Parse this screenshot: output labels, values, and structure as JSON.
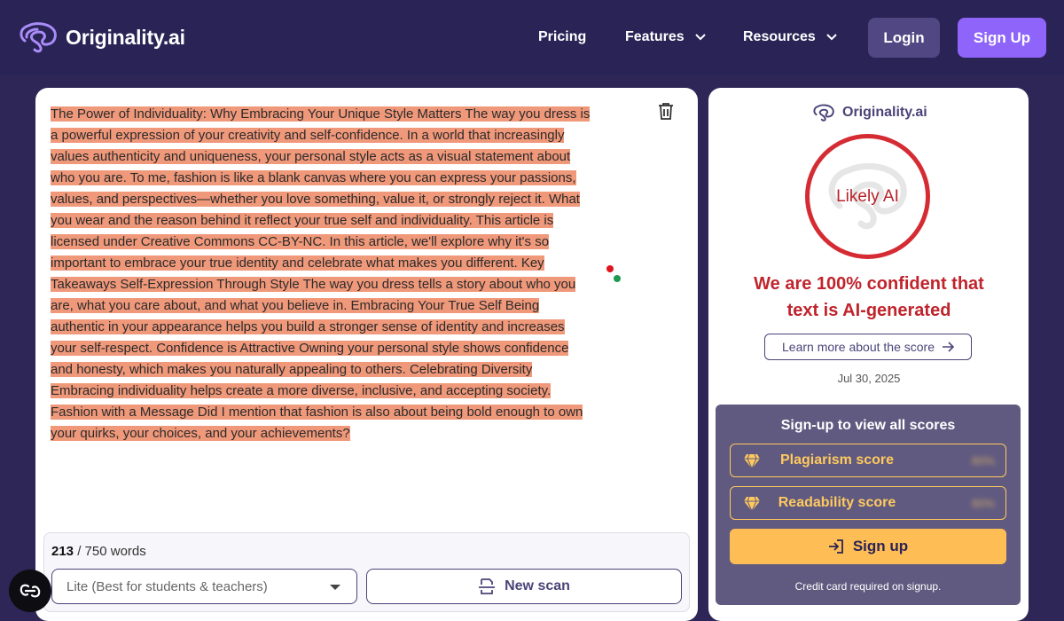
{
  "header": {
    "brand": "Originality.ai",
    "nav": [
      {
        "label": "Pricing"
      },
      {
        "label": "Features"
      },
      {
        "label": "Resources"
      }
    ],
    "login_label": "Login",
    "signup_label": "Sign Up"
  },
  "editor": {
    "text": "The Power of Individuality: Why Embracing Your Unique Style Matters The way you dress is a powerful expression of your creativity and self-confidence. In a world that increasingly values authenticity and uniqueness, your personal style acts as a visual statement about who you are. To me, fashion is like a blank canvas where you can express your passions, values, and perspectives—whether you love something, value it, or strongly reject it. What you wear and the reason behind it reflect your true self and individuality. This article is licensed under Creative Commons CC-BY-NC. In this article, we'll explore why it's so important to embrace your true identity and celebrate what makes you different. Key Takeaways Self-Expression Through Style The way you dress tells a story about who you are, what you care about, and what you believe in. Embracing Your True Self Being authentic in your appearance helps you build a stronger sense of identity and increases your self-respect. Confidence is Attractive Owning your personal style shows confidence and honesty, which makes you naturally appealing to others. Celebrating Diversity Embracing individuality helps create a more diverse, inclusive, and accepting society. Fashion with a Message Did I mention that fashion is also about being bold enough to own your quirks, your choices, and your achievements?",
    "lines": [
      "The Power of Individuality: Why Embracing Your Unique Style Matters The way you dress is",
      "a powerful expression of your creativity and self-confidence. In a world that increasingly",
      "values authenticity and uniqueness, your personal style acts as a visual statement about",
      "who you are. To me, fashion is like a blank canvas where you can express your passions,",
      "values, and perspectives—whether you love something, value it, or strongly reject it. What",
      "you wear and the reason behind it reflect your true self and individuality. This article is",
      "licensed under Creative Commons CC-BY-NC. In this article, we'll explore why it's so",
      "important to embrace your true identity and celebrate what makes you different. Key",
      "Takeaways Self-Expression Through Style The way you dress tells a story about who you",
      "are, what you care about, and what you believe in. Embracing Your True Self Being",
      "authentic in your appearance helps you build a stronger sense of identity and increases",
      "your self-respect. Confidence is Attractive Owning your personal style shows confidence",
      "and honesty, which makes you naturally appealing to others. Celebrating Diversity",
      "Embracing individuality helps create a more diverse, inclusive, and accepting society.",
      "Fashion with a Message Did I mention that fashion is also about being bold enough to own",
      "your quirks, your choices, and your achievements?"
    ],
    "word_count": "213",
    "word_limit": "/ 750 words",
    "model_select": "Lite (Best for students & teachers)",
    "new_scan_label": "New scan"
  },
  "results": {
    "brand": "Originality.ai",
    "score_label": "Likely AI",
    "confidence_line1": "We are 100% confident that",
    "confidence_line2": "text is AI-generated",
    "learn_more_label": "Learn more about the score",
    "date": "Jul 30, 2025",
    "signup_title": "Sign-up to view all scores",
    "plagiarism_label": "Plagiarism score",
    "readability_label": "Readability score",
    "hidden_score": "80%",
    "signup_cta": "Sign up",
    "cc_note": "Credit card required on signup."
  },
  "colors": {
    "highlight": "#f0987a",
    "ai_red": "#d52c34",
    "accent_purple": "#8f64fa",
    "gold": "#ffc95e"
  }
}
